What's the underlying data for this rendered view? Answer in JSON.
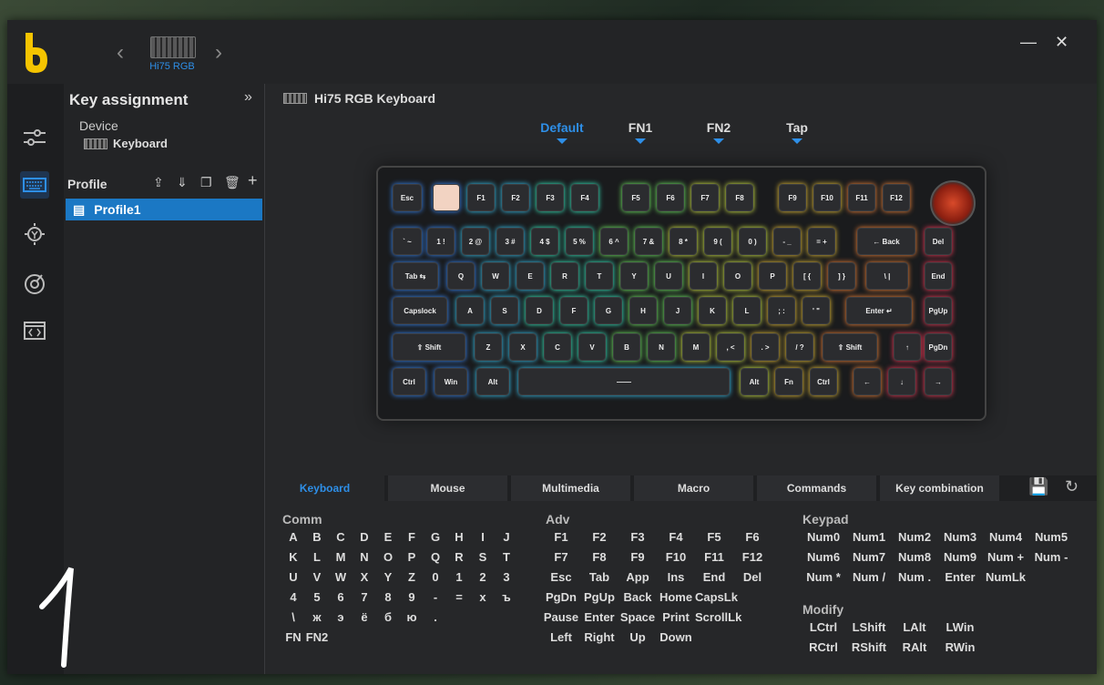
{
  "device": {
    "name": "Hi75 RGB"
  },
  "sidebar": {
    "title": "Key assignment",
    "collapse_icon": "»",
    "device_label": "Device",
    "device_value": "Keyboard",
    "profile_label": "Profile",
    "profiles": [
      "Profile1"
    ]
  },
  "main": {
    "keyboard_title": "Hi75 RGB Keyboard",
    "layers": [
      "Default",
      "FN1",
      "FN2",
      "Tap"
    ],
    "active_layer": "Default"
  },
  "keys": {
    "row0": [
      "Esc",
      "",
      "F1",
      "F2",
      "F3",
      "F4",
      "F5",
      "F6",
      "F7",
      "F8",
      "F9",
      "F10",
      "F11",
      "F12"
    ],
    "row1": [
      "` ~",
      "1 !",
      "2 @",
      "3 #",
      "4 $",
      "5 %",
      "6 ^",
      "7 &",
      "8 *",
      "9 (",
      "0 )",
      "- _",
      "= +",
      "← Back",
      "Del"
    ],
    "row2": [
      "Tab ⇆",
      "Q",
      "W",
      "E",
      "R",
      "T",
      "Y",
      "U",
      "I",
      "O",
      "P",
      "[ {",
      "] }",
      "\\ |",
      "End"
    ],
    "row3": [
      "Capslock",
      "A",
      "S",
      "D",
      "F",
      "G",
      "H",
      "J",
      "K",
      "L",
      "; :",
      "' \"",
      "Enter ↵",
      "PgUp"
    ],
    "row4": [
      "⇧ Shift",
      "Z",
      "X",
      "C",
      "V",
      "B",
      "N",
      "M",
      ", <",
      ". >",
      "/ ?",
      "⇧ Shift",
      "↑",
      "PgDn"
    ],
    "row5": [
      "Ctrl",
      "Win",
      "Alt",
      "——",
      "Alt",
      "Fn",
      "Ctrl",
      "←",
      "↓",
      "→"
    ]
  },
  "function_tabs": [
    "Keyboard",
    "Mouse",
    "Multimedia",
    "Macro",
    "Commands",
    "Key combination"
  ],
  "active_function_tab": "Keyboard",
  "sections": {
    "comm": {
      "title": "Comm",
      "rows": [
        [
          "A",
          "B",
          "C",
          "D",
          "E",
          "F",
          "G",
          "H",
          "I",
          "J"
        ],
        [
          "K",
          "L",
          "M",
          "N",
          "O",
          "P",
          "Q",
          "R",
          "S",
          "T"
        ],
        [
          "U",
          "V",
          "W",
          "X",
          "Y",
          "Z",
          "0",
          "1",
          "2",
          "3"
        ],
        [
          "4",
          "5",
          "6",
          "7",
          "8",
          "9",
          "-",
          "=",
          "x",
          "ъ"
        ],
        [
          "\\",
          "ж",
          "э",
          "ё",
          "б",
          "ю",
          "."
        ],
        [
          "FN",
          "FN2"
        ]
      ]
    },
    "adv": {
      "title": "Adv",
      "rows": [
        [
          "F1",
          "F2",
          "F3",
          "F4",
          "F5",
          "F6"
        ],
        [
          "F7",
          "F8",
          "F9",
          "F10",
          "F11",
          "F12"
        ],
        [
          "Esc",
          "Tab",
          "App",
          "Ins",
          "End",
          "Del"
        ],
        [
          "PgDn",
          "PgUp",
          "Back",
          "Home",
          "CapsLk"
        ],
        [
          "Pause",
          "Enter",
          "Space",
          "Print",
          "ScrollLk"
        ],
        [
          "Left",
          "Right",
          "Up",
          "Down"
        ]
      ]
    },
    "keypad": {
      "title": "Keypad",
      "rows": [
        [
          "Num0",
          "Num1",
          "Num2",
          "Num3",
          "Num4",
          "Num5"
        ],
        [
          "Num6",
          "Num7",
          "Num8",
          "Num9",
          "Num +",
          "Num -"
        ],
        [
          "Num *",
          "Num /",
          "Num .",
          "Enter",
          "NumLk"
        ]
      ]
    },
    "modify": {
      "title": "Modify",
      "rows": [
        [
          "LCtrl",
          "LShift",
          "LAlt",
          "LWin"
        ],
        [
          "RCtrl",
          "RShift",
          "RAlt",
          "RWin"
        ]
      ]
    }
  },
  "annotation": "1",
  "colors": {
    "accent": "#2e8fe8",
    "selected": "#1b78c4",
    "logo": "#f5c400"
  }
}
